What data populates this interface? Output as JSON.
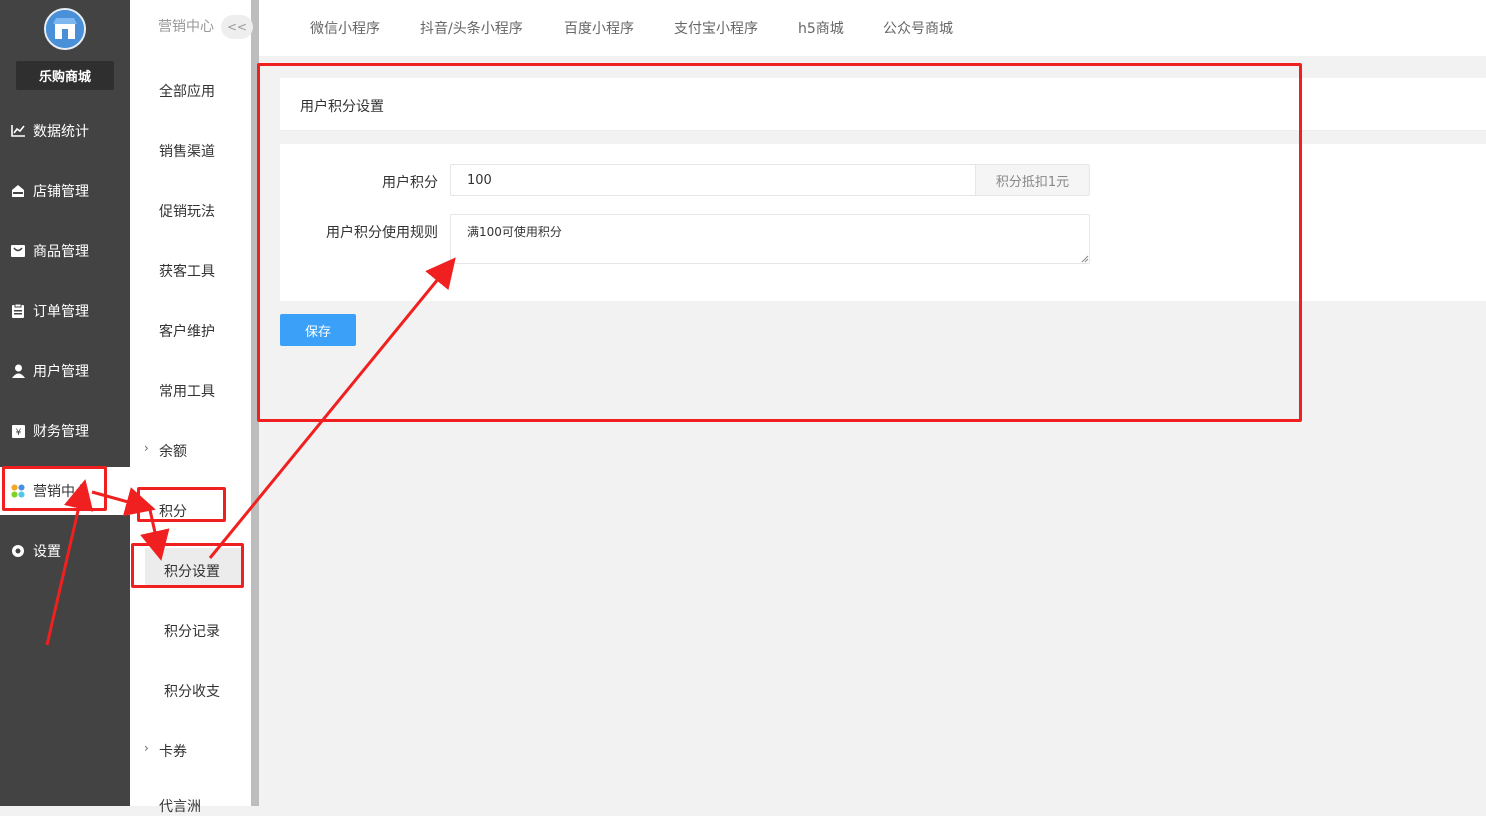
{
  "sidebar": {
    "shop_name": "乐购商城",
    "items": [
      {
        "label": "数据统计",
        "icon": "line-chart-icon"
      },
      {
        "label": "店铺管理",
        "icon": "store-icon"
      },
      {
        "label": "商品管理",
        "icon": "bag-icon"
      },
      {
        "label": "订单管理",
        "icon": "clipboard-icon"
      },
      {
        "label": "用户管理",
        "icon": "user-icon"
      },
      {
        "label": "财务管理",
        "icon": "yen-icon"
      },
      {
        "label": "营销中心",
        "icon": "marketing-icon",
        "active": true
      },
      {
        "label": "设置",
        "icon": "gear-icon"
      }
    ]
  },
  "subnav": {
    "header": "营销中心",
    "collapse": "<<",
    "items": [
      "全部应用",
      "销售渠道",
      "促销玩法",
      "获客工具",
      "客户维护",
      "常用工具"
    ],
    "balance": "余额",
    "points": "积分",
    "points_children": [
      "积分设置",
      "积分记录",
      "积分收支"
    ],
    "coupons": "卡券",
    "more": "代言洲"
  },
  "top_tabs": [
    "微信小程序",
    "抖音/头条小程序",
    "百度小程序",
    "支付宝小程序",
    "h5商城",
    "公众号商城"
  ],
  "content": {
    "card_title": "用户积分设置",
    "points_label": "用户积分",
    "points_value": "100",
    "points_suffix": "积分抵扣1元",
    "rule_label": "用户积分使用规则",
    "rule_value": "满100可使用积分",
    "save_label": "保存"
  },
  "colors": {
    "sidebar_bg": "#434343",
    "primary": "#3ba1f8",
    "annotation_red": "#f02020"
  }
}
